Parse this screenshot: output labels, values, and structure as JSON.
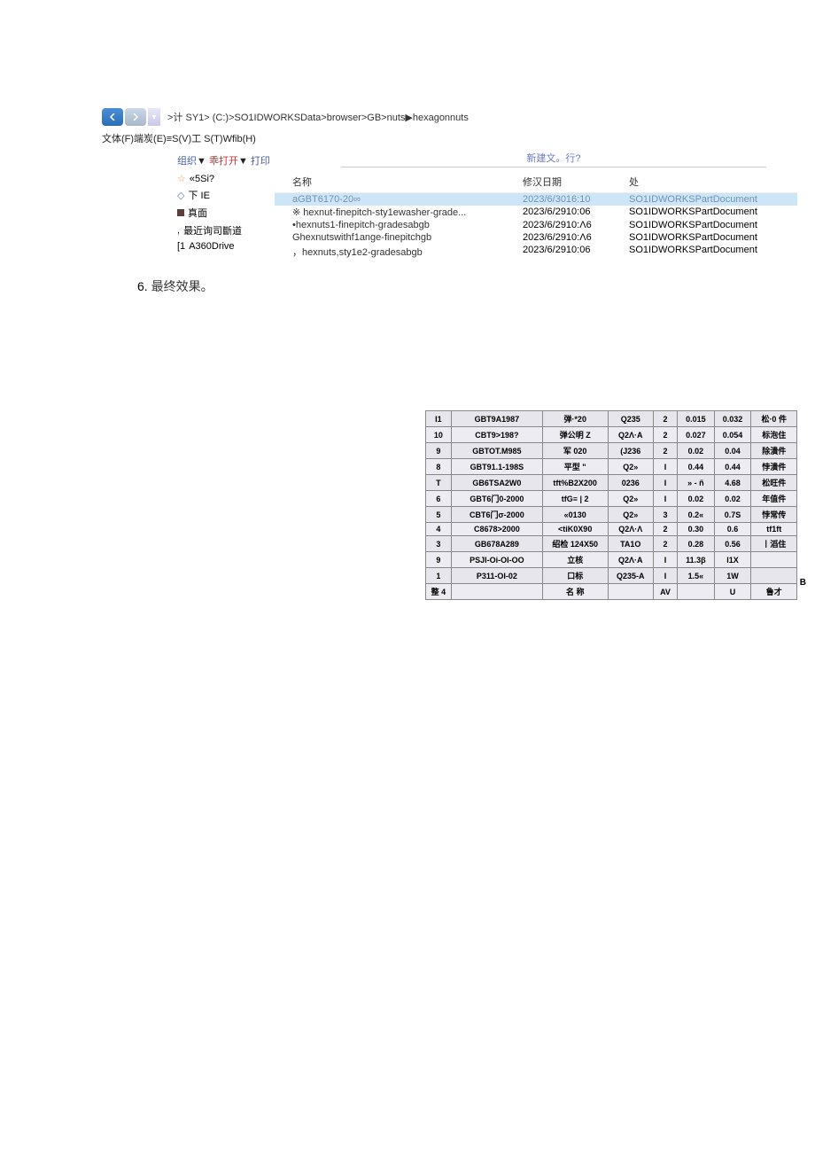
{
  "breadcrumb": ">计 SY1> (C:)>SO1IDWORKSData>browser>GB>nuts▶hexagonnuts",
  "menubar": "文体(F)端炭(E)≡S(V)工 S(T)Wfib(H)",
  "toolbar": {
    "org": "组织",
    "arrow": "▼",
    "open": "乖打开",
    "print": "打印",
    "newfile": "新建文。行?"
  },
  "sidebar": [
    {
      "icon": "star",
      "label": "«5Si?"
    },
    {
      "icon": "dot",
      "label": "下 IE"
    },
    {
      "icon": "sq",
      "label": "真面"
    },
    {
      "icon": "comma",
      "label": "最近询司斷道"
    },
    {
      "icon": "bar",
      "label": "A360Drive"
    }
  ],
  "cols": {
    "name": "名称",
    "date": "修汉日期",
    "type": "处"
  },
  "files": [
    {
      "name": "aGBT6170-20∞",
      "date": "2023/6/3016:10",
      "type": "SO1IDWORKSPartDocument",
      "sel": true
    },
    {
      "name": "※ hexnut-finepitch-sty1ewasher-grade...",
      "date": "2023/6/2910:06",
      "type": "SO1IDWORKSPartDocument"
    },
    {
      "name": "•hexnuts1-finepitch-gradesabgb",
      "date": "2023/6/2910:Λ6",
      "type": "SO1IDWORKSPartDocument"
    },
    {
      "name": "Ghexnutswithf1ange-finepitchgb",
      "date": "2023/6/2910:Λ6",
      "type": "SO1IDWORKSPartDocument"
    },
    {
      "name": "，hexnuts,sty1e2-gradesabgb",
      "date": "2023/6/2910:06",
      "type": "SO1IDWORKSPartDocument"
    }
  ],
  "note": {
    "num": "6.",
    "text": "最终效果。"
  },
  "bom_headers_last": [
    "整 4",
    "",
    "名 称",
    "",
    "AV",
    "",
    "U",
    "鲁才"
  ],
  "bom": [
    [
      "I1",
      "GBT9A1987",
      "弹·*20",
      "Q235",
      "2",
      "0.015",
      "0.032",
      "松·0 件"
    ],
    [
      "10",
      "CBT9>198?",
      "弹公明 Z",
      "Q2Λ·A",
      "2",
      "0.027",
      "0.054",
      "标泡住"
    ],
    [
      "9",
      "GBTOT.M985",
      "军 020",
      "(J236",
      "2",
      "0.02",
      "0.04",
      "除潰件"
    ],
    [
      "8",
      "GBT91.1-198S",
      "平型 \"",
      "Q2»",
      "I",
      "0.44",
      "0.44",
      "悖潰件"
    ],
    [
      "T",
      "GB6TSA2W0",
      "tft%B2X200",
      "0236",
      "I",
      "» - ñ",
      "4.68",
      "松旺件"
    ],
    [
      "6",
      "GBT6门0-2000",
      "tfG≡ | 2",
      "Q2»",
      "I",
      "0.02",
      "0.02",
      "年值件"
    ],
    [
      "5",
      "CBT6门σ-2000",
      "«0130",
      "Q2»",
      "3",
      "0.2«",
      "0.7S",
      "悖常传"
    ],
    [
      "4",
      "C8678>2000",
      "<tiK0X90",
      "Q2Λ·Λ",
      "2",
      "0.30",
      "0.6",
      "tf1ft"
    ],
    [
      "3",
      "GB678A289",
      "绍检 124X50",
      "TA1O",
      "2",
      "0.28",
      "0.56",
      "丨滔住"
    ],
    [
      "9",
      "PSJI-Oi-OI-OO",
      "立核",
      "Q2Λ·A",
      "I",
      "11.3β",
      "I1X",
      ""
    ],
    [
      "1",
      "P311-OI-02",
      "口标",
      "Q235-A",
      "I",
      "1.5«",
      "1W",
      ""
    ]
  ],
  "side_label": "B"
}
